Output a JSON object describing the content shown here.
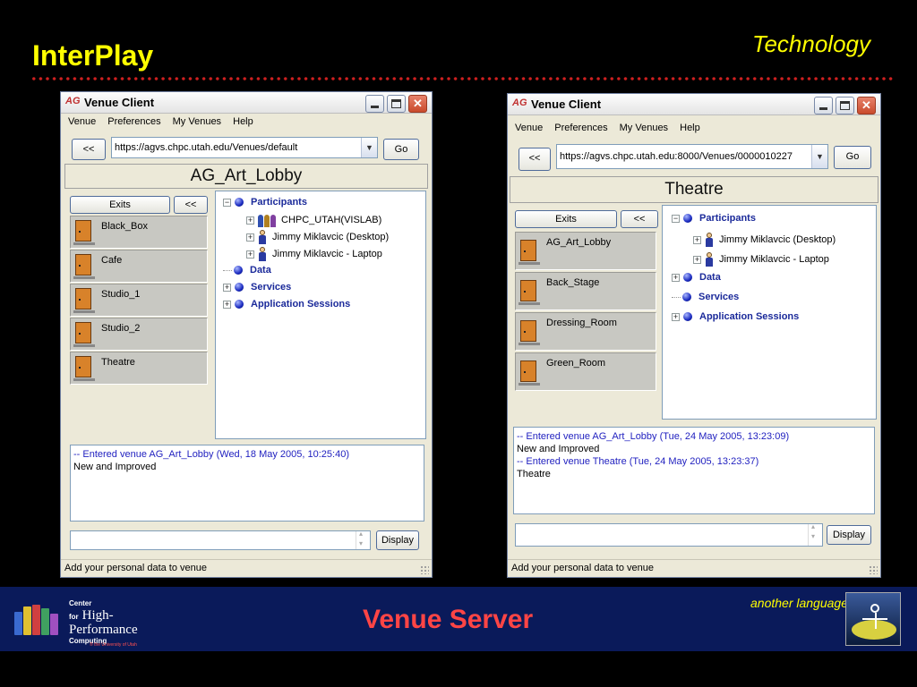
{
  "slide": {
    "title": "InterPlay",
    "topic": "Technology"
  },
  "left_window": {
    "app_logo": "AG",
    "title": "Venue Client",
    "menu": [
      "Venue",
      "Preferences",
      "My Venues",
      "Help"
    ],
    "back_label": "<<",
    "url": "https://agvs.chpc.utah.edu/Venues/default",
    "go_label": "Go",
    "venue_name": "AG_Art_Lobby",
    "exits_label": "Exits",
    "collapse_label": "<<",
    "exits": [
      "Black_Box",
      "Cafe",
      "Studio_1",
      "Studio_2",
      "Theatre"
    ],
    "tree": {
      "participants_label": "Participants",
      "participants": [
        "CHPC_UTAH(VISLAB)",
        "Jimmy Miklavcic (Desktop)",
        "Jimmy Miklavcic - Laptop"
      ],
      "data_label": "Data",
      "services_label": "Services",
      "sessions_label": "Application Sessions"
    },
    "log": [
      {
        "text": "-- Entered venue AG_Art_Lobby (Wed, 18 May 2005, 10:25:40)",
        "kind": "event"
      },
      {
        "text": "New and Improved",
        "kind": "text"
      }
    ],
    "chat_input_value": "",
    "display_label": "Display",
    "status": "Add your personal data to venue"
  },
  "right_window": {
    "app_logo": "AG",
    "title": "Venue Client",
    "menu": [
      "Venue",
      "Preferences",
      "My Venues",
      "Help"
    ],
    "back_label": "<<",
    "url": "https://agvs.chpc.utah.edu:8000/Venues/0000010227",
    "go_label": "Go",
    "venue_name": "Theatre",
    "exits_label": "Exits",
    "collapse_label": "<<",
    "exits": [
      "AG_Art_Lobby",
      "Back_Stage",
      "Dressing_Room",
      "Green_Room"
    ],
    "tree": {
      "participants_label": "Participants",
      "participants": [
        "Jimmy Miklavcic (Desktop)",
        "Jimmy Miklavcic - Laptop"
      ],
      "data_label": "Data",
      "services_label": "Services",
      "sessions_label": "Application Sessions"
    },
    "log": [
      {
        "text": "-- Entered venue AG_Art_Lobby (Tue, 24 May 2005, 13:23:09)",
        "kind": "event"
      },
      {
        "text": "New and Improved",
        "kind": "text"
      },
      {
        "text": "-- Entered venue Theatre (Tue, 24 May 2005, 13:23:37)",
        "kind": "event"
      },
      {
        "text": "Theatre",
        "kind": "text"
      }
    ],
    "chat_input_value": "",
    "display_label": "Display",
    "status": "Add your personal data to venue"
  },
  "footer": {
    "logo_center": "Center",
    "logo_for": "for",
    "logo_high": "High-",
    "logo_performance": "Performance",
    "logo_computing": "Computing",
    "logo_university": "® the University of Utah",
    "title": "Venue Server",
    "note": "another language"
  },
  "colors": {
    "slide_title": "#ffff00",
    "dot_rule": "#d02020",
    "footer_bg": "#0a1a5a",
    "footer_title": "#ff4545",
    "tree_category": "#1b2a9a",
    "log_event": "#2222c0"
  },
  "icons": {
    "window_minimize": "minimize-icon",
    "window_maximize": "maximize-icon",
    "window_close": "close-icon",
    "url_dropdown": "chevron-down-icon",
    "exit": "door-icon",
    "tree_category": "blue-ball-icon",
    "participant": "person-icon",
    "participant_group": "group-icon"
  }
}
